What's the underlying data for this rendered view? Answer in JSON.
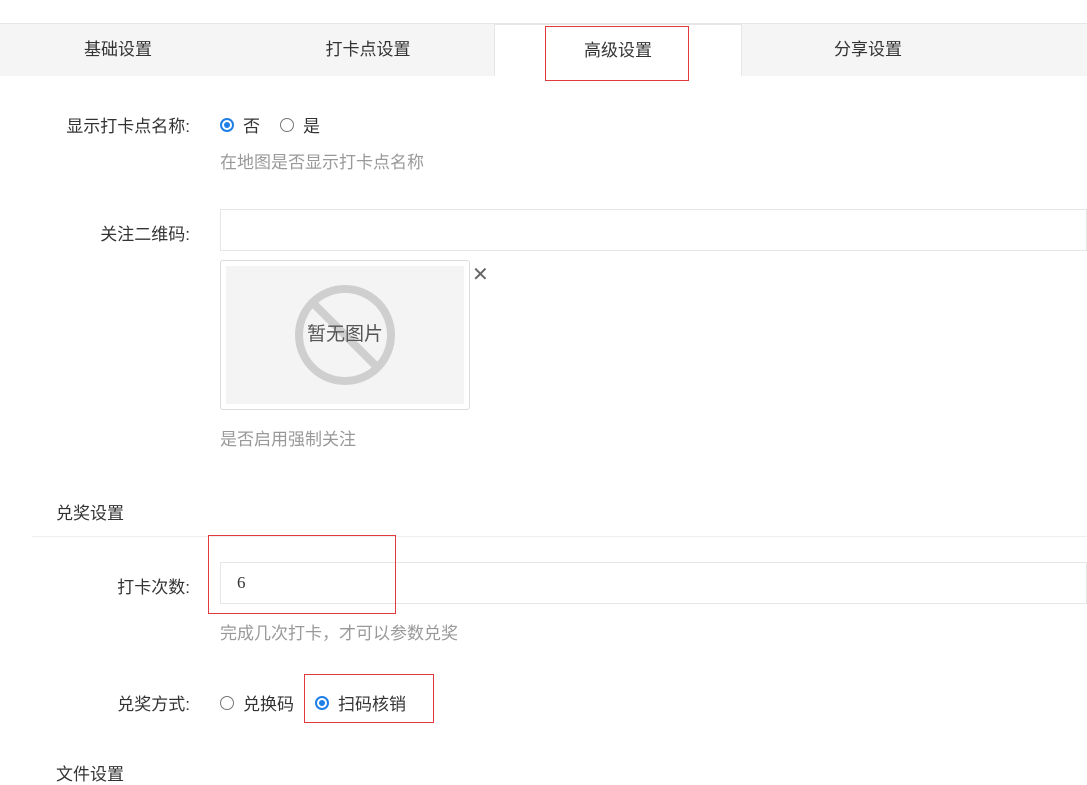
{
  "tabs": [
    {
      "label": "基础设置",
      "active": false
    },
    {
      "label": "打卡点设置",
      "active": false
    },
    {
      "label": "高级设置",
      "active": true
    },
    {
      "label": "分享设置",
      "active": false
    }
  ],
  "show_name": {
    "label": "显示打卡点名称:",
    "options": [
      {
        "label": "否",
        "checked": true
      },
      {
        "label": "是",
        "checked": false
      }
    ],
    "hint": "在地图是否显示打卡点名称"
  },
  "qrcode": {
    "label": "关注二维码:",
    "input_value": "",
    "placeholder_image_text": "暂无图片",
    "remove_glyph": "✕",
    "hint": "是否启用强制关注"
  },
  "prize_section": {
    "title": "兑奖设置",
    "checkin_count": {
      "label": "打卡次数:",
      "value": "6",
      "hint": "完成几次打卡，才可以参数兑奖"
    },
    "method": {
      "label": "兑奖方式:",
      "options": [
        {
          "label": "兑换码",
          "checked": false
        },
        {
          "label": "扫码核销",
          "checked": true
        }
      ]
    }
  },
  "next_section": {
    "title": "文件设置"
  },
  "colors": {
    "accent": "#1e7fe6",
    "highlight_box": "#e0393e"
  }
}
